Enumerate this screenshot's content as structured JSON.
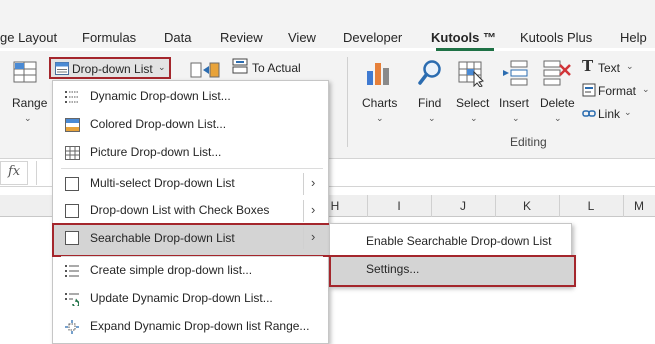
{
  "ribbon_tabs": [
    "ge Layout",
    "Formulas",
    "Data",
    "Review",
    "View",
    "Developer",
    "Kutools ™",
    "Kutools Plus",
    "Help"
  ],
  "active_tab": "Kutools ™",
  "accent_color": "#1e7145",
  "highlight_color": "#a4262c",
  "ribbon": {
    "range_label": "Range",
    "dropdown_list_label": "Drop-down List",
    "to_actual_label": "To Actual",
    "charts_label": "Charts",
    "find_label": "Find",
    "select_label": "Select",
    "insert_label": "Insert",
    "delete_label": "Delete",
    "text_label": "Text",
    "format_label": "Format",
    "link_label": "Link",
    "group_editing": "Editing"
  },
  "formula_bar": {
    "fx": "fx"
  },
  "columns": [
    "H",
    "I",
    "J",
    "K",
    "L",
    "M"
  ],
  "menu": {
    "items": [
      {
        "label": "Dynamic Drop-down List...",
        "icon": "dynamic-list-icon"
      },
      {
        "label": "Colored Drop-down List...",
        "icon": "colored-list-icon"
      },
      {
        "label": "Picture Drop-down List...",
        "icon": "picture-list-icon"
      },
      {
        "label": "Multi-select Drop-down List",
        "icon": "checkbox-icon",
        "submenu": true
      },
      {
        "label": "Drop-down List with Check Boxes",
        "icon": "checkbox-icon",
        "submenu": true
      },
      {
        "label": "Searchable Drop-down List",
        "icon": "checkbox-icon",
        "submenu": true,
        "selected": true
      },
      {
        "label": "Create simple drop-down list...",
        "icon": "simple-list-icon"
      },
      {
        "label": "Update Dynamic Drop-down List...",
        "icon": "update-list-icon"
      },
      {
        "label": "Expand Dynamic Drop-down list Range...",
        "icon": "expand-range-icon"
      }
    ]
  },
  "submenu": {
    "items": [
      {
        "label": "Enable Searchable Drop-down List"
      },
      {
        "label": "Settings...",
        "selected": true
      }
    ]
  }
}
